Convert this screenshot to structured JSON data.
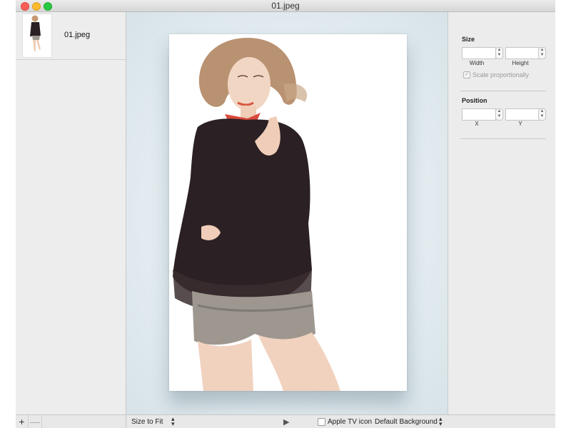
{
  "window": {
    "title": "01.jpeg"
  },
  "sidebar": {
    "files": [
      {
        "name": "01.jpeg"
      }
    ],
    "add_label": "+",
    "remove_label": "—"
  },
  "canvas": {
    "image_subject": "woman-in-black-blouse-and-sequin-shorts"
  },
  "bottombar": {
    "zoom_mode": "Size to Fit",
    "apple_tv_icon_label": "Apple TV icon",
    "apple_tv_icon_checked": false,
    "background_mode": "Default Background"
  },
  "inspector": {
    "size": {
      "heading": "Size",
      "width_label": "Width",
      "height_label": "Height",
      "width_value": "",
      "height_value": "",
      "scale_label": "Scale proportionally",
      "scale_checked": true
    },
    "position": {
      "heading": "Position",
      "x_label": "X",
      "y_label": "Y",
      "x_value": "",
      "y_value": ""
    }
  },
  "colors": {
    "close": "#fc5f57",
    "minimize": "#fdbc2e",
    "maximize": "#28c940",
    "canvas_bg": "#e3ecf0"
  }
}
